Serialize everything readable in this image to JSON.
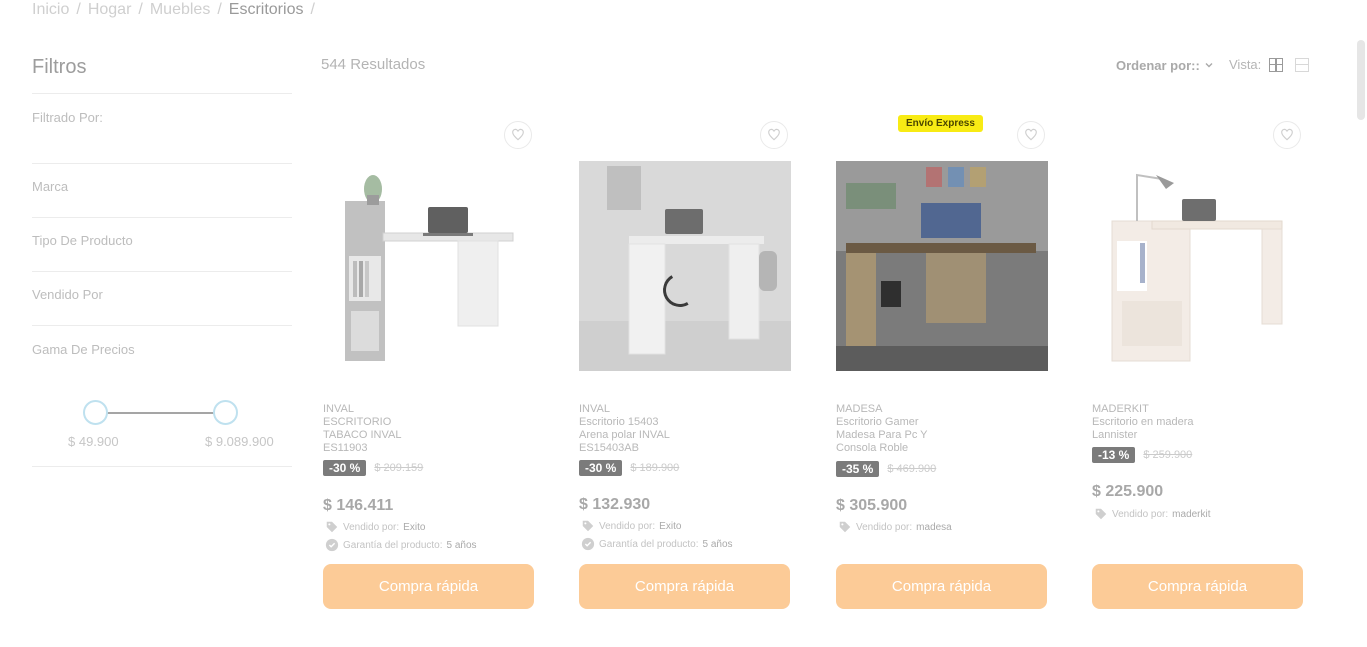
{
  "breadcrumb": [
    "Inicio",
    "Hogar",
    "Muebles",
    "Escritorios"
  ],
  "filters": {
    "title": "Filtros",
    "filtered_by": "Filtrado Por:",
    "groups": [
      "Marca",
      "Tipo De Producto",
      "Vendido Por",
      "Gama De Precios"
    ],
    "price_min": "$ 49.900",
    "price_max": "$ 9.089.900"
  },
  "results_label": "544 Resultados",
  "sort_label": "Ordenar por::",
  "view_label": "Vista:",
  "products": [
    {
      "brand": "INVAL",
      "name": "ESCRITORIO TABACO INVAL ES11903",
      "discount": "-30 %",
      "old_price": "$ 209.159",
      "price": "$ 146.411",
      "sold_by_label": "Vendido por:",
      "seller": "Exito",
      "warranty_label": "Garantía del producto:",
      "warranty": "5 años",
      "button": "Compra rápida"
    },
    {
      "brand": "INVAL",
      "name": "Escritorio 15403 Arena polar INVAL ES15403AB",
      "discount": "-30 %",
      "old_price": "$ 189.900",
      "price": "$ 132.930",
      "sold_by_label": "Vendido por:",
      "seller": "Exito",
      "warranty_label": "Garantía del producto:",
      "warranty": "5 años",
      "button": "Compra rápida"
    },
    {
      "badge": "Envío Express",
      "brand": "MADESA",
      "name": "Escritorio Gamer Madesa Para Pc Y Consola Roble",
      "discount": "-35 %",
      "old_price": "$ 469.900",
      "price": "$ 305.900",
      "sold_by_label": "Vendido por:",
      "seller": "madesa",
      "button": "Compra rápida"
    },
    {
      "brand": "MADERKIT",
      "name": "Escritorio en madera Lannister",
      "discount": "-13 %",
      "old_price": "$ 259.900",
      "price": "$ 225.900",
      "sold_by_label": "Vendido por:",
      "seller": "maderkit",
      "button": "Compra rápida"
    }
  ]
}
